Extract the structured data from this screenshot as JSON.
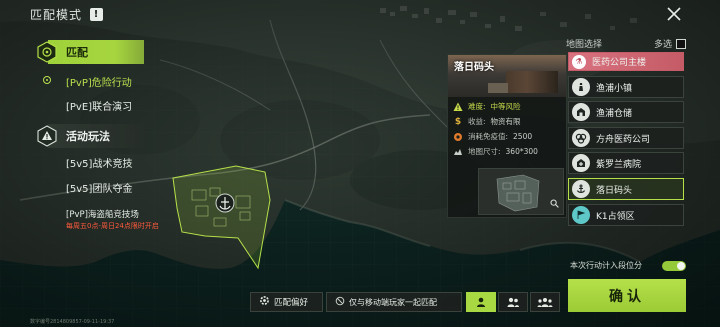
{
  "header": {
    "title": "匹配模式",
    "badge": "!",
    "close_icon": "close-icon"
  },
  "menu": {
    "sections": [
      {
        "label": "匹配",
        "icon": "target-hex-icon",
        "items": [
          {
            "label": "[PvP]危险行动",
            "active": true
          },
          {
            "label": "[PvE]联合演习",
            "active": false
          }
        ]
      },
      {
        "label": "活动玩法",
        "icon": "warning-hex-icon",
        "items": [
          {
            "label": "[5v5]战术竞技",
            "active": false
          },
          {
            "label": "[5v5]团队夺金",
            "active": false
          },
          {
            "label": "[PvP]海盗船竞技场",
            "active": false,
            "note": "每周五0点-周日24点限时开启"
          }
        ]
      }
    ]
  },
  "location_card": {
    "name": "落日码头",
    "danger_label": "难度:",
    "danger_value": "中等风险",
    "loot_label": "收益:",
    "loot_value": "物资有限",
    "cost_label": "消耗免疫值:",
    "cost_value": "2500",
    "size_label": "地图尺寸:",
    "size_value": "360*300"
  },
  "region_list": {
    "title": "地图选择",
    "multi_label": "多选",
    "items": [
      {
        "label": "医药公司主楼",
        "icon": "flask-icon",
        "state": "top"
      },
      {
        "label": "渔浦小镇",
        "icon": "lighthouse-icon",
        "state": "normal"
      },
      {
        "label": "渔浦仓储",
        "icon": "warehouse-icon",
        "state": "normal"
      },
      {
        "label": "方舟医药公司",
        "icon": "biohazard-icon",
        "state": "normal"
      },
      {
        "label": "紫罗兰病院",
        "icon": "hospital-icon",
        "state": "normal"
      },
      {
        "label": "落日码头",
        "icon": "anchor-icon",
        "state": "selected"
      },
      {
        "label": "K1占领区",
        "icon": "flag-icon",
        "state": "teal"
      }
    ]
  },
  "bottom": {
    "toggle_label": "本次行动计入段位分",
    "toggle_on": true,
    "confirm_label": "确认",
    "pref_label": "匹配偏好",
    "party_label": "仅与移动端玩家一起匹配",
    "team_modes": [
      "solo-icon",
      "duo-icon",
      "squad-icon"
    ],
    "footer_id": "数字编号2814809857-09-11-19:37"
  },
  "colors": {
    "accent": "#a6d53f",
    "danger_text": "#ff5a3c",
    "top_item": "#d9737f"
  }
}
